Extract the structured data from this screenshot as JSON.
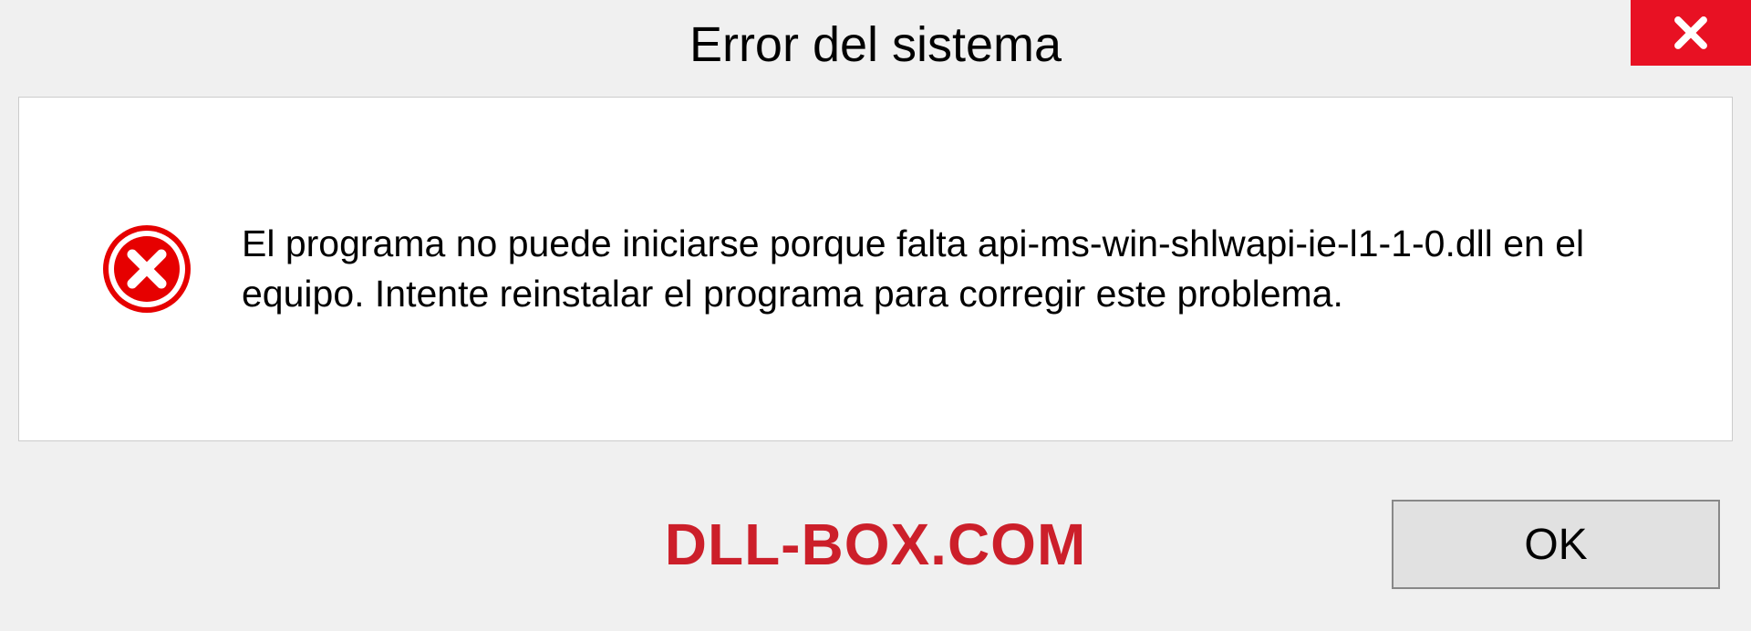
{
  "dialog": {
    "title": "Error del sistema",
    "message": "El programa no puede iniciarse porque falta api-ms-win-shlwapi-ie-l1-1-0.dll en el equipo. Intente reinstalar el programa para corregir este problema.",
    "ok_label": "OK"
  },
  "watermark": "DLL-BOX.COM",
  "colors": {
    "close_bg": "#e81123",
    "error_icon": "#e60000",
    "watermark": "#cc1f2a"
  }
}
